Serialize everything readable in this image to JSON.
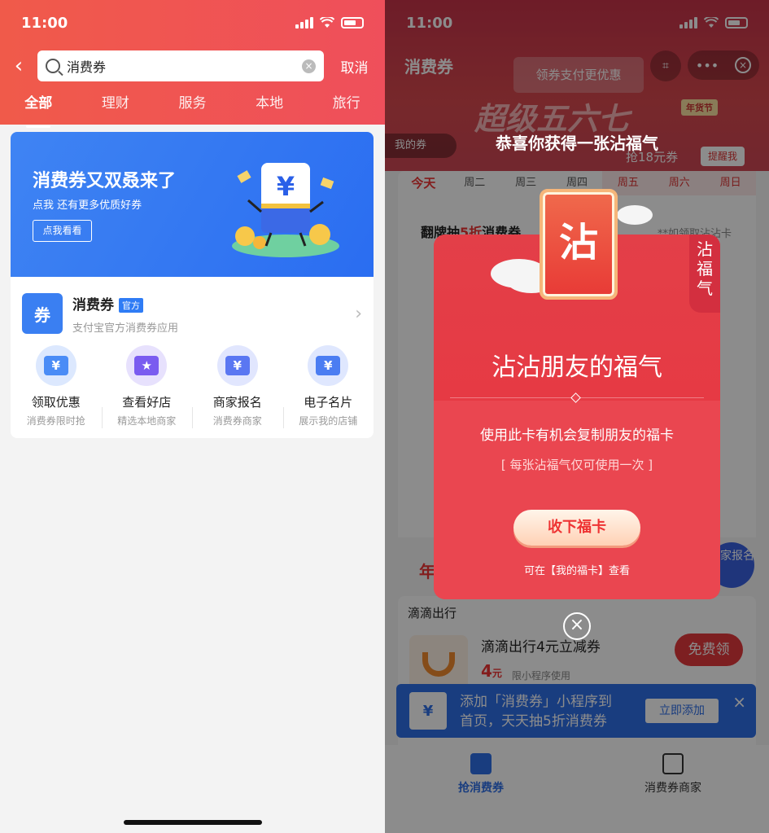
{
  "left": {
    "status": {
      "time": "11:00"
    },
    "search": {
      "back_icon": "chevron-left-icon",
      "query": "消费券",
      "cancel": "取消"
    },
    "tabs": [
      "全部",
      "理财",
      "服务",
      "本地",
      "旅行"
    ],
    "active_tab": "全部",
    "banner": {
      "title": "消费券又双叒来了",
      "subtitle": "点我 还有更多优质好券",
      "button": "点我看看"
    },
    "app": {
      "logo_text": "券",
      "name": "消费券",
      "badge": "官方",
      "desc": "支付宝官方消费券应用"
    },
    "grid": [
      {
        "label": "领取优惠",
        "sub": "消费券限时抢",
        "color": "#4a8cf6",
        "glyph": "¥"
      },
      {
        "label": "查看好店",
        "sub": "精选本地商家",
        "color": "#7a5cf0",
        "glyph": "★"
      },
      {
        "label": "商家报名",
        "sub": "消费券商家",
        "color": "#5a77f2",
        "glyph": "¥"
      },
      {
        "label": "电子名片",
        "sub": "展示我的店铺",
        "color": "#4b7df2",
        "glyph": "¥"
      }
    ]
  },
  "right": {
    "status": {
      "time": "11:00"
    },
    "title": "消费券",
    "promo": "领券支付更优惠",
    "big_banner": "超级五六七",
    "year_badge": "年货节",
    "my_coupon": "我的券",
    "grab": "抢18元券",
    "remind": "提醒我",
    "days": [
      "今天",
      "周二",
      "周三",
      "周四",
      "周五",
      "周六",
      "周日"
    ],
    "flip_title": "翻牌抽",
    "flip_highlight": "5折",
    "flip_suffix": "消费券",
    "flip_hint": "**如领取沾沾卡",
    "year_cut": "年",
    "merchant_float": "商家报名",
    "didi": {
      "title": "滴滴出行",
      "name": "滴滴出行4元立减券",
      "price": "4",
      "unit": "元",
      "limit": "限小程序使用",
      "button": "免费领"
    },
    "add_bar": {
      "icon": "¥",
      "text_line1": "添加「消费券」小程序到",
      "text_line2": "首页，天天抽5折消费券",
      "button": "立即添加"
    },
    "bottom_nav": [
      {
        "label": "抢消费券",
        "active": true
      },
      {
        "label": "消费券商家",
        "active": false
      }
    ],
    "modal": {
      "congrats": "恭喜你获得一张沾福气",
      "coin_char": "沾",
      "tag": "沾福气",
      "title": "沾沾朋友的福气",
      "desc": "使用此卡有机会复制朋友的福卡",
      "note": "[ 每张沾福气仅可使用一次 ]",
      "accept": "收下福卡",
      "view": "可在【我的福卡】查看"
    }
  }
}
